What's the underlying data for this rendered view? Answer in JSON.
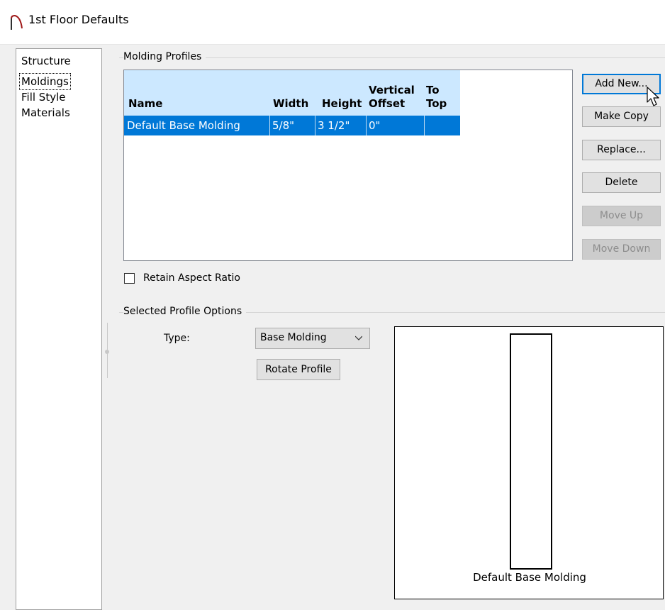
{
  "window": {
    "title": "1st Floor Defaults"
  },
  "nav": {
    "items": [
      "Structure",
      "Moldings",
      "Fill Style",
      "Materials"
    ],
    "selected": "Moldings"
  },
  "molding_profiles": {
    "group_label": "Molding Profiles",
    "columns": [
      "Name",
      "Width",
      "Height",
      "Vertical Offset",
      "To Top"
    ],
    "rows": [
      {
        "name": "Default Base Molding",
        "width": "5/8\"",
        "height": "3 1/2\"",
        "vertical_offset": "0\"",
        "to_top": ""
      }
    ],
    "buttons": {
      "add_new": "Add New...",
      "make_copy": "Make Copy",
      "replace": "Replace...",
      "delete": "Delete",
      "move_up": "Move Up",
      "move_down": "Move Down"
    },
    "retain_aspect_ratio": {
      "label": "Retain Aspect Ratio",
      "checked": false
    }
  },
  "selected_profile_options": {
    "group_label": "Selected Profile Options",
    "type_label": "Type:",
    "type_value": "Base Molding",
    "rotate_button": "Rotate Profile",
    "preview_label": "Default Base Molding"
  },
  "colors": {
    "selection": "#0078d7",
    "header": "#cce8ff",
    "window_bg": "#f0f0f0"
  },
  "icons": {
    "title": "molding-profile-icon",
    "cursor": "arrow-cursor-icon",
    "dropdown": "chevron-down-icon"
  }
}
